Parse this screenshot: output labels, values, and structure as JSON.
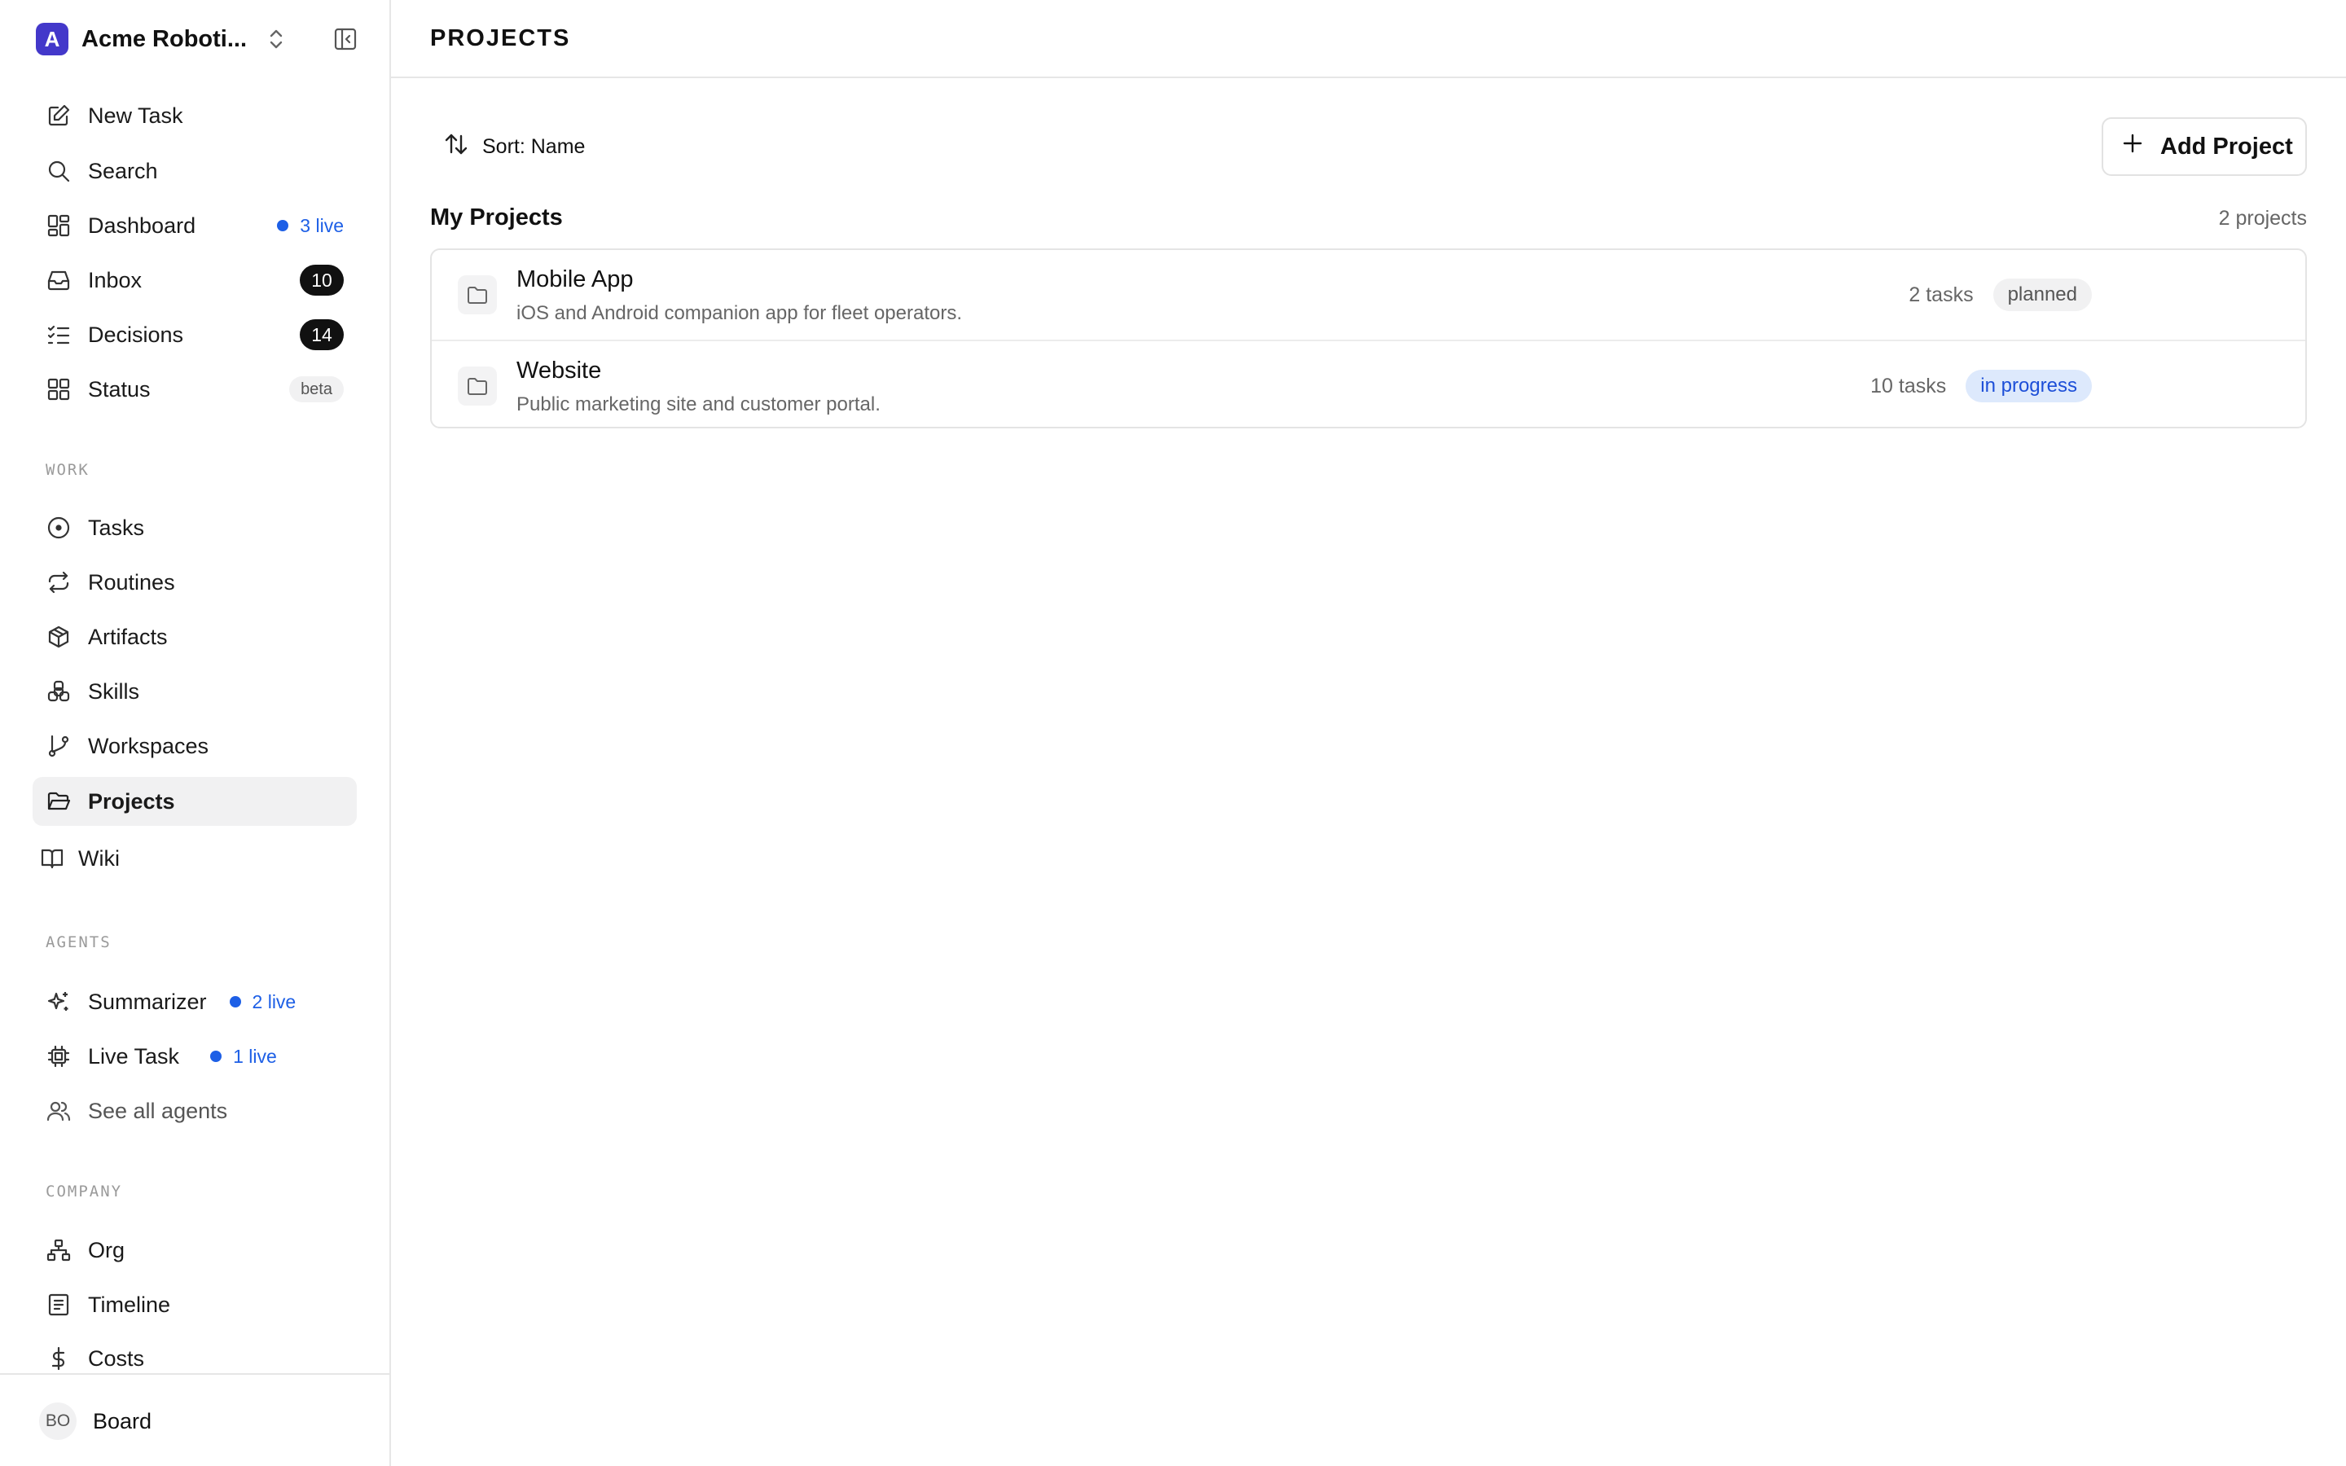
{
  "workspace": {
    "initial": "A",
    "name": "Acme Roboti..."
  },
  "sidebar": {
    "primary": [
      {
        "label": "New Task"
      },
      {
        "label": "Search"
      },
      {
        "label": "Dashboard",
        "live": "3 live"
      },
      {
        "label": "Inbox",
        "count": "10"
      },
      {
        "label": "Decisions",
        "count": "14"
      },
      {
        "label": "Status",
        "badge": "beta"
      }
    ],
    "work_label": "WORK",
    "work": [
      {
        "label": "Tasks"
      },
      {
        "label": "Routines"
      },
      {
        "label": "Artifacts"
      },
      {
        "label": "Skills"
      },
      {
        "label": "Workspaces"
      },
      {
        "label": "Projects"
      },
      {
        "label": "Wiki"
      }
    ],
    "agents_label": "AGENTS",
    "agents": [
      {
        "label": "Summarizer",
        "live": "2 live"
      },
      {
        "label": "Live Task",
        "live": "1 live"
      },
      {
        "label": "See all agents"
      }
    ],
    "company_label": "COMPANY",
    "company": [
      {
        "label": "Org"
      },
      {
        "label": "Timeline"
      },
      {
        "label": "Costs"
      }
    ],
    "footer": {
      "initials": "BO",
      "label": "Board"
    }
  },
  "page": {
    "title": "PROJECTS",
    "sort_label": "Sort: Name",
    "add_label": "Add Project",
    "list_title": "My Projects",
    "list_count": "2 projects",
    "projects": [
      {
        "name": "Mobile App",
        "description": "iOS and Android companion app for fleet operators.",
        "tasks": "2 tasks",
        "status": "planned"
      },
      {
        "name": "Website",
        "description": "Public marketing site and customer portal.",
        "tasks": "10 tasks",
        "status": "in progress"
      }
    ]
  },
  "colors": {
    "accent": "#1d5fe6",
    "workspace_avatar": "#4338ca",
    "active_item_bg": "#f1f1f2",
    "in_progress_bg": "#dde9fc",
    "in_progress_text": "#1d4fd8"
  },
  "icons": {
    "workspace_switch": "chevron-up-down-icon",
    "collapse": "sidebar-collapse-icon",
    "new_task": "pencil-square-icon",
    "search": "search-icon",
    "dashboard": "dashboard-grid-icon",
    "inbox": "inbox-icon",
    "decisions": "checklist-icon",
    "status": "grid-icon",
    "tasks": "circle-dot-icon",
    "routines": "repeat-icon",
    "artifacts": "cube-icon",
    "skills": "skills-cluster-icon",
    "workspaces": "git-branch-icon",
    "projects": "folder-open-icon",
    "wiki": "book-icon",
    "summarizer": "sparkles-icon",
    "live_task": "cpu-chip-icon",
    "see_all_agents": "users-icon",
    "org": "org-chart-icon",
    "timeline": "document-list-icon",
    "costs": "dollar-icon",
    "sort": "sort-arrows-icon",
    "add": "plus-icon",
    "project": "folder-icon"
  }
}
